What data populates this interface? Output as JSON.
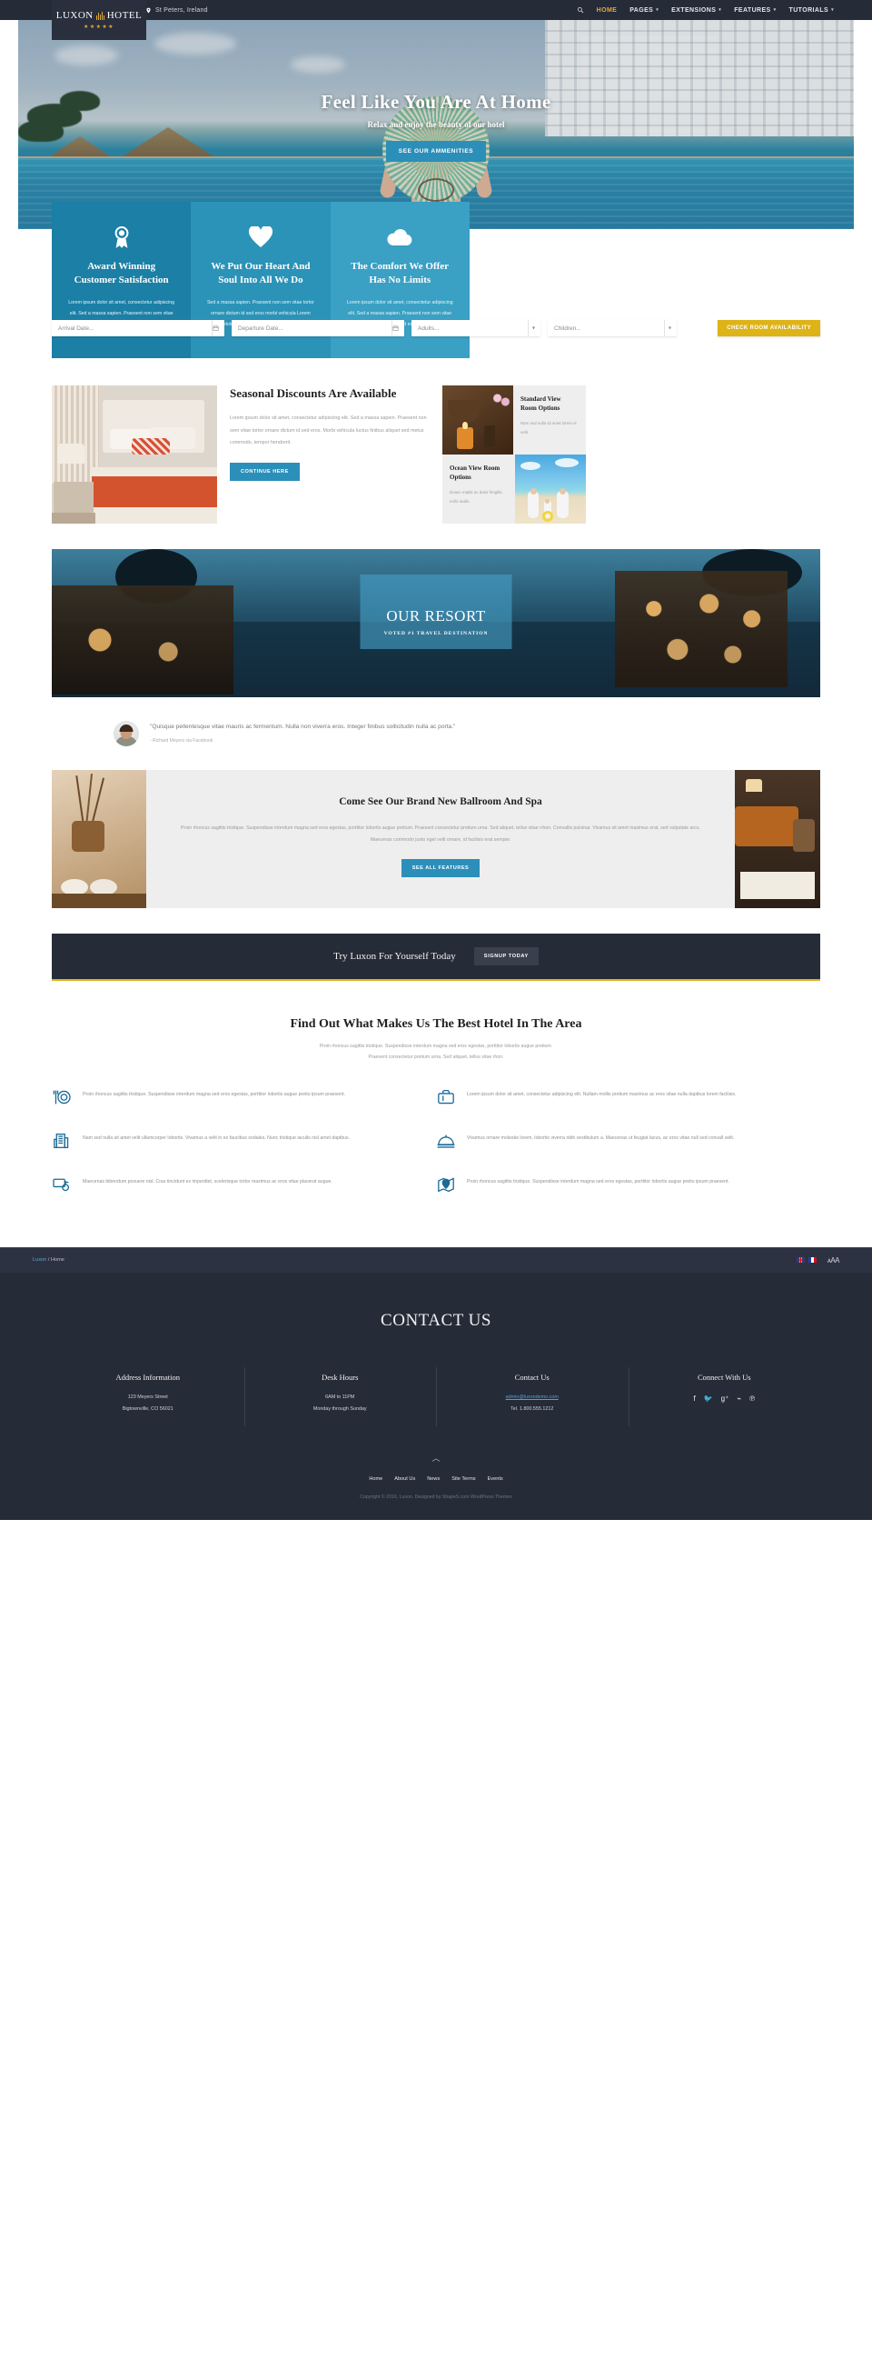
{
  "brand": {
    "name_left": "LUXON",
    "name_right": "HOTEL",
    "stars": "★★★★★"
  },
  "topbar": {
    "location": "St Peters, Ireland",
    "search_icon": "search-icon",
    "nav": [
      {
        "label": "HOME",
        "active": true,
        "caret": ""
      },
      {
        "label": "PAGES",
        "active": false,
        "caret": "▾"
      },
      {
        "label": "EXTENSIONS",
        "active": false,
        "caret": "▾"
      },
      {
        "label": "FEATURES",
        "active": false,
        "caret": "▾"
      },
      {
        "label": "TUTORIALS",
        "active": false,
        "caret": "▾"
      }
    ]
  },
  "hero": {
    "title": "Feel Like You Are At Home",
    "subtitle": "Relax and enjoy the beauty of our hotel",
    "button": "SEE OUR AMMENITIES"
  },
  "booking": {
    "arrival_placeholder": "Arrival Date...",
    "departure_placeholder": "Departure Date...",
    "adults_value": "Adults...",
    "children_value": "Children...",
    "submit": "CHECK ROOM AVAILABILITY"
  },
  "features_top": [
    {
      "icon": "award-ribbon-icon",
      "title": "Award Winning Customer Satisfaction",
      "text": "Lorem ipsum dolor sit amet, consectetur adipiscing elit. Sed a massa sapien. Praesent non sem vitae tortor ornare dictum id sed eros morbi vehicula",
      "color": "#1b7fa6"
    },
    {
      "icon": "heart-icon",
      "title": "We Put Our Heart And Soul Into All We Do",
      "text": "Sed a massa sapien. Praesent non sem vitae tortor ornare dictum id sed eros morbi vehicula Lorem ipsum dolor sit amet, consectetur adipiscing elit.",
      "color": "#2b93b8"
    },
    {
      "icon": "cloud-icon",
      "title": "The Comfort We Offer Has No Limits",
      "text": "Lorem ipsum dolor sit amet, consectetur adipiscing elit. Sed a massa sapien. Praesent non sem vitae tortor ornare dictum id sed eros morbi vehicula",
      "color": "#3aa0c4"
    }
  ],
  "seasonal": {
    "image_alt": "hotel-bedroom-photo",
    "title": "Seasonal Discounts Are Available",
    "text": "Lorem ipsum dolor sit amet, consectetur adipiscing elit. Sed a massa sapien. Praesent non sem vitae tortor ornare dictum id sed eros. Morbi vehicula luctus finibus aliquet sed metus commodo, tempor hendrerit.",
    "button": "CONTINUE HERE",
    "cards": [
      {
        "title": "Standard View Room Options",
        "text": "Nam sed nulla sit amet lorem el velit.",
        "image_alt": "spa-bowl-candle-photo"
      },
      {
        "title": "Ocean View Room Options",
        "text": "Donec mattis ac dolor fringilla sollic itudin.",
        "image_alt": "family-on-beach-photo"
      }
    ]
  },
  "resort": {
    "title": "OUR RESORT",
    "subtitle": "VOTED #1 TRAVEL DESTINATION",
    "image_alt": "resort-villas-at-dusk-photo"
  },
  "testimonial": {
    "avatar_alt": "richard-meyers-avatar",
    "quote": "\"Quisque pellentesque vitae mauris ac fermentum. Nulla non viverra eros. Integer finibus sollicitudin nulla ac porta.\"",
    "author": "- Richard Meyers via Facebook"
  },
  "ballroom": {
    "left_image_alt": "spa-reeds-and-towels-photo",
    "title": "Come See Our Brand New Ballroom And Spa",
    "text": "Proin rhoncus sagittis tristique. Suspendisse interdum magna sed eros egestas, porttitor lobortis augue pretium. Praesent consectetur pretium urna. Sed aliquet, tellus vitae rrhon. Convallis pulvinar. Vivamus sit amet maximus erat, sed vulputate arcu. Maecenas commodo justo eget velit ornare, id facilisis erat semper.",
    "button": "SEE ALL FEATURES",
    "right_image_alt": "restaurant-interior-photo"
  },
  "cta": {
    "heading": "Try Luxon For Yourself Today",
    "button": "SIGNUP TODAY"
  },
  "findout": {
    "heading": "Find Out What Makes Us The Best Hotel In The Area",
    "text_line1": "Proin rhoncus sagittis tristique. Suspendisse interdum magna sed eros egestas, porttitor lobortis augue pretium.",
    "text_line2": "Praesent consectetur pretium urna. Sed aliquet, tellus vitae rhon.",
    "items": [
      {
        "icon": "dining-plate-fork-icon",
        "text": "Proin rhoncus sagittis tristique. Suspendisse interdum magna sed eros egestas, porttitor lobortis augue pretiu ipsum praesent."
      },
      {
        "icon": "suitcase-icon",
        "text": "Lorem ipsum dolor sit amet, consectetur adipiscing elit. Nullam mollis pretium maximus ac eros vitae nulla dapibus lorem facilisis."
      },
      {
        "icon": "building-icon",
        "text": "Nam sed nulla sit amet velit ullamcorper lobortis. Vivamus a velit in ex faucibus sodales. Nunc tristique iaculis nisl amet dapibus."
      },
      {
        "icon": "room-service-bell-icon",
        "text": "Vivamus ornare molestie lorem, lobortis viverra nibh vestibulum a. Maecenas ut feugiat lacus, ac eros vitae null sed convall velit."
      },
      {
        "icon": "key-card-icon",
        "text": "Maecenas bibendum posuere nisl. Cras tincidunt ex imperdiet, scelerisque tortor maximus ac eros vitae placerat augue."
      },
      {
        "icon": "map-pin-icon",
        "text": "Proin rhoncus sagittis tristique. Suspendisse interdum magna sed eros egestas, porttitor lobortis augue pretiu ipsum praesent."
      }
    ]
  },
  "breadcrumb": {
    "home_link": "Luxon",
    "separator": "/",
    "current": "Home",
    "flags": [
      "uk-flag-icon",
      "fr-flag-icon"
    ],
    "fontsize_label": "ᴀAA"
  },
  "footer": {
    "heading": "CONTACT US",
    "columns": [
      {
        "title": "Address Information",
        "lines": [
          "123 Meyers Street",
          "Bigtownville, CO 56021"
        ]
      },
      {
        "title": "Desk Hours",
        "lines": [
          "6AM to 11PM",
          "Monday through Sunday"
        ]
      },
      {
        "title": "Contact Us",
        "email": "admin@luxondemo.com",
        "lines": [
          "Tel. 1.800.555.1212"
        ]
      },
      {
        "title": "Connect With Us",
        "socials": [
          "facebook-icon",
          "twitter-icon",
          "google-plus-icon",
          "rss-icon",
          "pinterest-icon"
        ]
      }
    ],
    "back_to_top": "back-to-top-icon",
    "nav": [
      "Home",
      "About Us",
      "News",
      "Site Terms",
      "Events"
    ],
    "copyright": "Copyright © 2016, Luxon. Designed by ShapeS.com WordPress Themes"
  }
}
